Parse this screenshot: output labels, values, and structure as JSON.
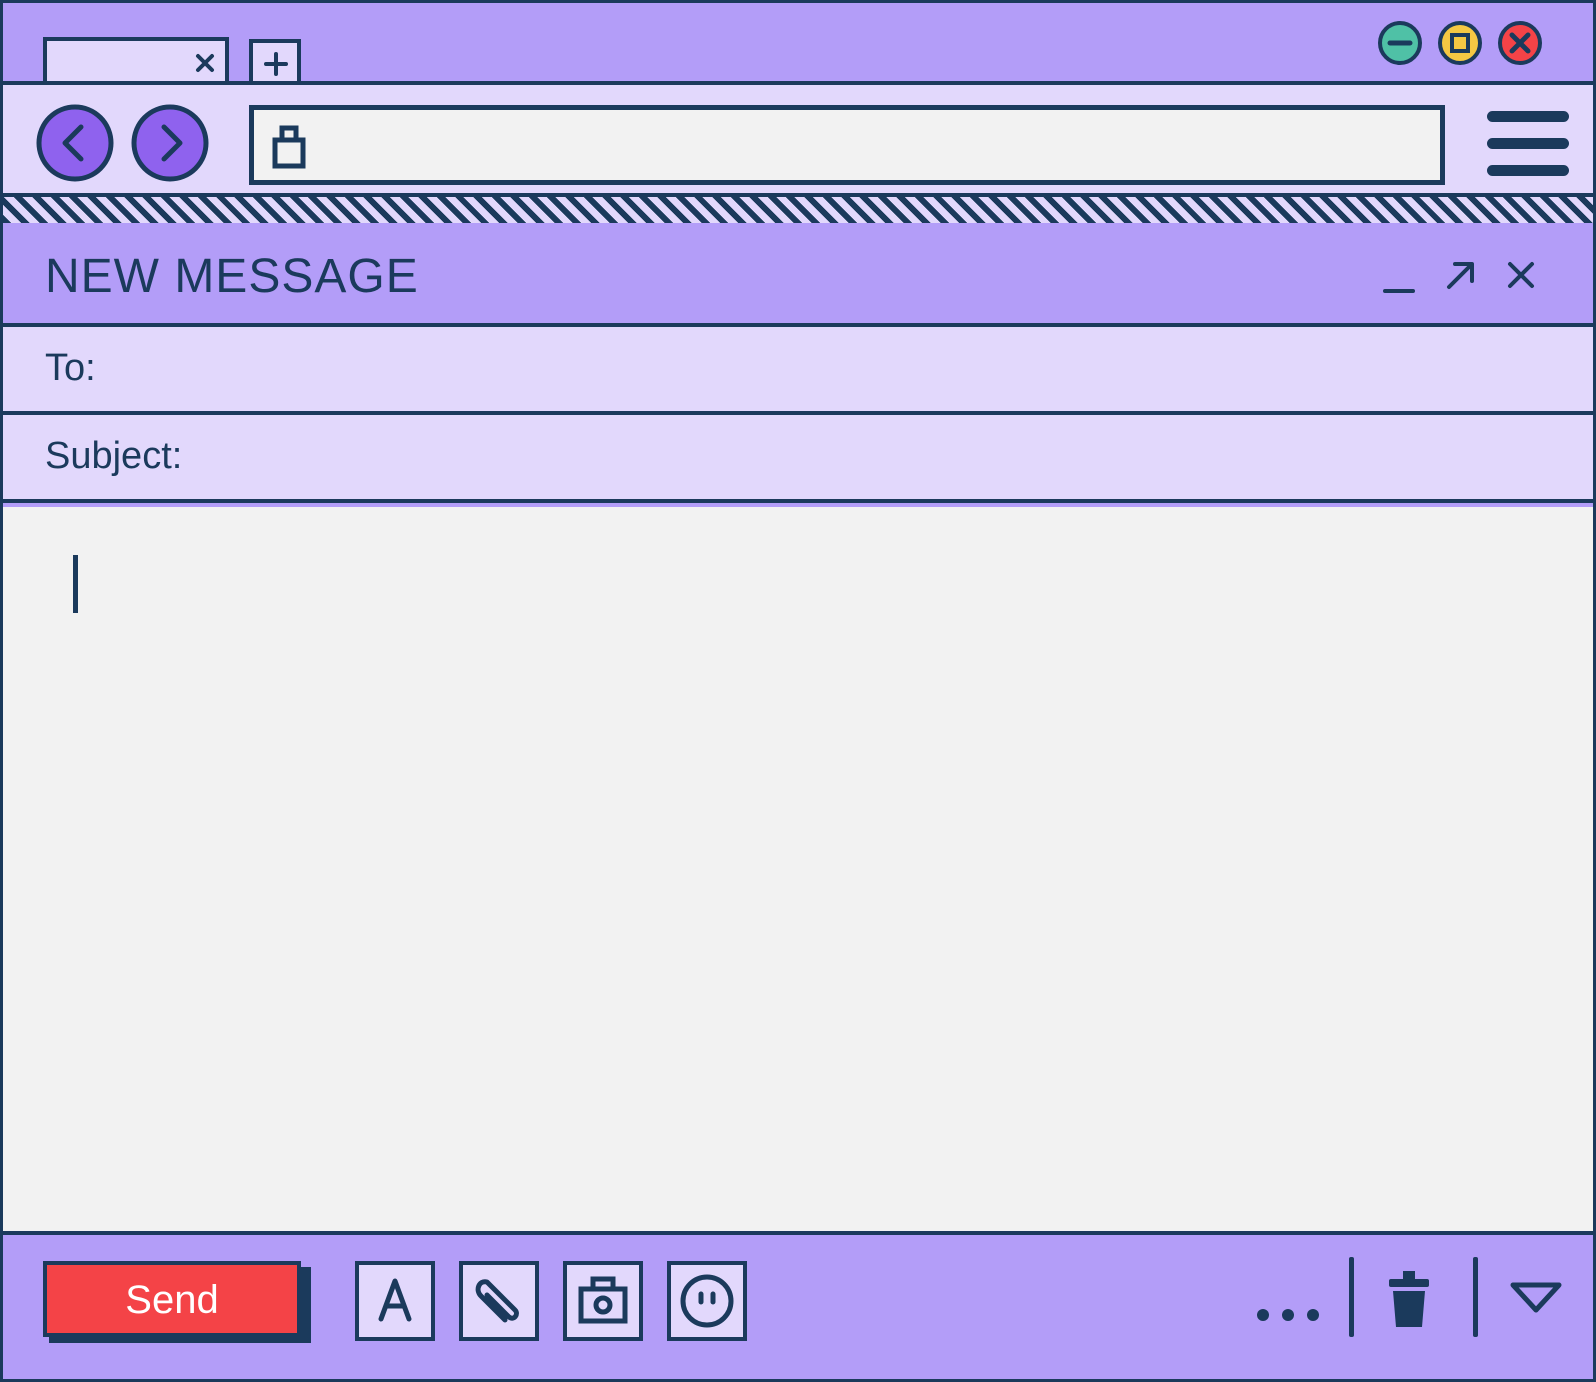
{
  "browser": {
    "tab": {
      "close_icon": "close-icon"
    },
    "new_tab_icon": "plus-icon",
    "window_controls": [
      {
        "name": "minimize",
        "color": "#4fc1a6"
      },
      {
        "name": "maximize",
        "color": "#f5c843"
      },
      {
        "name": "close",
        "color": "#f44347"
      }
    ],
    "address": {
      "value": "",
      "icon": "lock-icon"
    },
    "nav": {
      "back_icon": "chevron-left-icon",
      "forward_icon": "chevron-right-icon",
      "menu_icon": "hamburger-icon"
    }
  },
  "compose": {
    "title": "NEW MESSAGE",
    "header_controls": [
      "minimize-icon",
      "expand-icon",
      "close-icon"
    ],
    "to_label": "To:",
    "to_value": "",
    "subject_label": "Subject:",
    "subject_value": "",
    "body_value": ""
  },
  "toolbar": {
    "send_label": "Send",
    "tools": [
      "text-format-icon",
      "paperclip-icon",
      "camera-icon",
      "emoji-icon"
    ],
    "more_icon": "more-dots-icon",
    "trash_icon": "trash-icon",
    "dropdown_icon": "triangle-down-icon"
  },
  "colors": {
    "outline": "#1b3a5c",
    "purple": "#b39df8",
    "lavender": "#e2d8fc",
    "canvas": "#f2f2f2",
    "send": "#f44347",
    "minimize": "#4fc1a6",
    "maximize": "#f5c843",
    "close": "#f44347"
  }
}
